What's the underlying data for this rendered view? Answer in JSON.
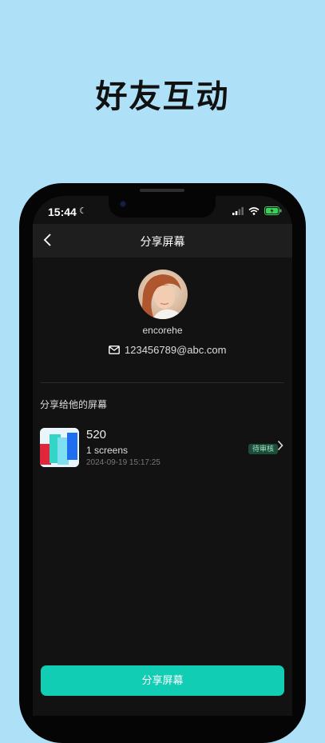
{
  "promo": {
    "title": "好友互动"
  },
  "status_bar": {
    "time": "15:44",
    "battery_color": "#3ad15a"
  },
  "header": {
    "title": "分享屏幕",
    "back_icon": "chevron-left-icon"
  },
  "profile": {
    "username": "encorehe",
    "email": "123456789@abc.com"
  },
  "section": {
    "title": "分享给他的屏幕"
  },
  "items": [
    {
      "name": "520",
      "count": "1 screens",
      "date": "2024-09-19 15:17:25",
      "status": "待审核"
    }
  ],
  "actions": {
    "share_label": "分享屏幕"
  },
  "colors": {
    "accent": "#10cdb3",
    "background": "#aee0f7",
    "screen": "#121212"
  }
}
